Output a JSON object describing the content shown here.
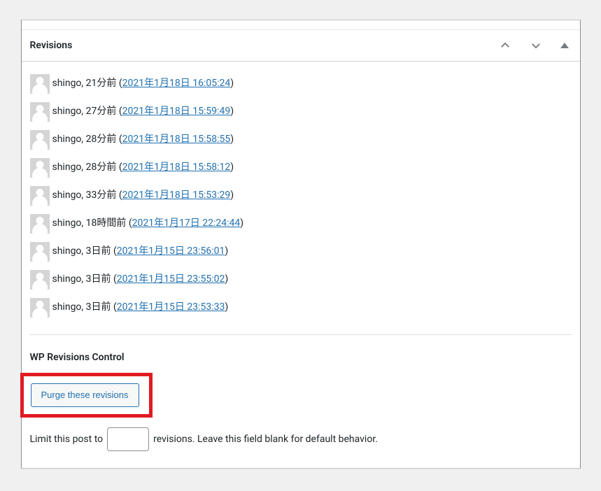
{
  "panel": {
    "title": "Revisions"
  },
  "revisions": [
    {
      "author": "shingo",
      "ago": "21分前",
      "timestamp": "2021年1月18日 16:05:24"
    },
    {
      "author": "shingo",
      "ago": "27分前",
      "timestamp": "2021年1月18日 15:59:49"
    },
    {
      "author": "shingo",
      "ago": "28分前",
      "timestamp": "2021年1月18日 15:58:55"
    },
    {
      "author": "shingo",
      "ago": "28分前",
      "timestamp": "2021年1月18日 15:58:12"
    },
    {
      "author": "shingo",
      "ago": "33分前",
      "timestamp": "2021年1月18日 15:53:29"
    },
    {
      "author": "shingo",
      "ago": "18時間前",
      "timestamp": "2021年1月17日 22:24:44"
    },
    {
      "author": "shingo",
      "ago": "3日前",
      "timestamp": "2021年1月15日 23:56:01"
    },
    {
      "author": "shingo",
      "ago": "3日前",
      "timestamp": "2021年1月15日 23:55:02"
    },
    {
      "author": "shingo",
      "ago": "3日前",
      "timestamp": "2021年1月15日 23:53:33"
    }
  ],
  "wprc": {
    "title": "WP Revisions Control",
    "purge_button": "Purge these revisions",
    "limit_prefix": "Limit this post to",
    "limit_value": "",
    "limit_suffix": "revisions. Leave this field blank for default behavior."
  }
}
